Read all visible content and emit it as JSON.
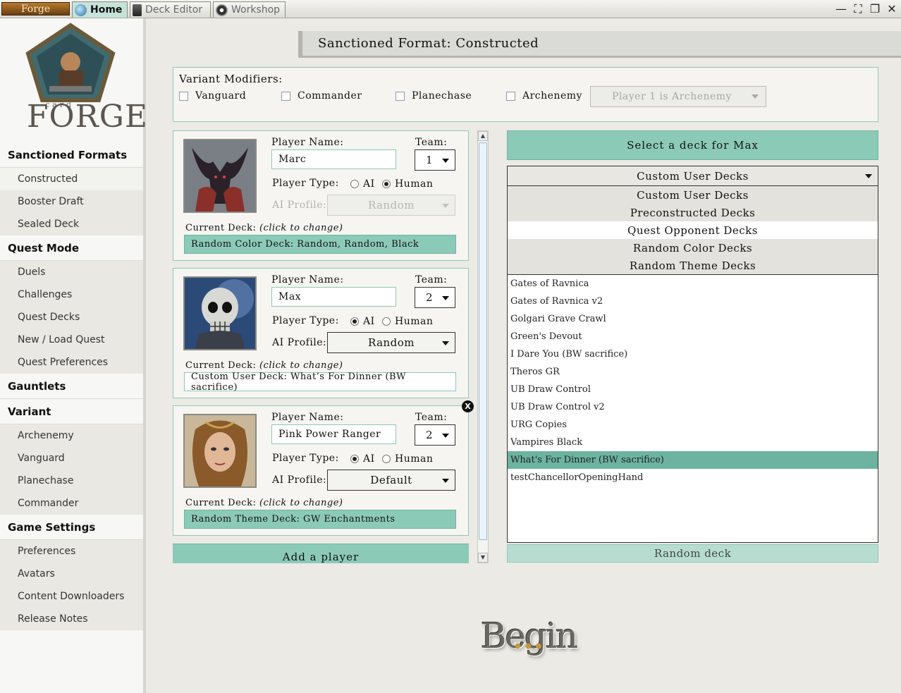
{
  "topbar": {
    "forge_label": "Forge",
    "tabs": [
      {
        "label": "Home",
        "icon": "home-globe-icon",
        "active": true
      },
      {
        "label": "Deck Editor",
        "icon": "deck-icon",
        "active": false
      },
      {
        "label": "Workshop",
        "icon": "workshop-icon",
        "active": false
      }
    ],
    "controls": {
      "minimize": "—",
      "fullscreen": "⛶",
      "restore": "❐",
      "close": "✕"
    }
  },
  "logo": {
    "small": "card",
    "big": "FORGE"
  },
  "sidebar": {
    "sections": [
      {
        "title": "Sanctioned Formats",
        "items": [
          "Constructed",
          "Booster Draft",
          "Sealed Deck"
        ]
      },
      {
        "title": "Quest Mode",
        "items": [
          "Duels",
          "Challenges",
          "Quest Decks",
          "New / Load Quest",
          "Quest Preferences"
        ]
      },
      {
        "title": "Gauntlets",
        "items": []
      },
      {
        "title": "Variant",
        "items": [
          "Archenemy",
          "Vanguard",
          "Planechase",
          "Commander"
        ]
      },
      {
        "title": "Game Settings",
        "items": [
          "Preferences",
          "Avatars",
          "Content Downloaders",
          "Release Notes"
        ]
      }
    ]
  },
  "main": {
    "format_title": "Sanctioned Format: Constructed",
    "variants": {
      "label": "Variant Modifiers:",
      "options": [
        "Vanguard",
        "Commander",
        "Planechase",
        "Archenemy"
      ],
      "archenemy_select": "Player 1 is Archenemy"
    },
    "labels": {
      "player_name": "Player Name:",
      "team": "Team:",
      "player_type": "Player Type:",
      "ai": "AI",
      "human": "Human",
      "ai_profile": "AI Profile:",
      "current_deck": "Current Deck:",
      "click_to_change": "(click to change)"
    },
    "players": [
      {
        "name": "Marc",
        "team": "1",
        "type": "Human",
        "ai_profile": "Random",
        "deck": "Random Color Deck: Random, Random, Black"
      },
      {
        "name": "Max",
        "team": "2",
        "type": "AI",
        "ai_profile": "Random",
        "deck": "Custom User Deck: What’s For Dinner (BW sacrifice)"
      },
      {
        "name": "Pink Power Ranger",
        "team": "2",
        "type": "AI",
        "ai_profile": "Default",
        "deck": "Random Theme Deck: GW Enchantments"
      }
    ],
    "add_player": "Add a player",
    "remove_icon": "X"
  },
  "deck_panel": {
    "header": "Select a deck for Max",
    "selected_category": "Custom User Decks",
    "categories": [
      "Custom User Decks",
      "Preconstructed Decks",
      "Quest Opponent Decks",
      "Random Color Decks",
      "Random Theme Decks"
    ],
    "hovered_category": "Quest Opponent Decks",
    "decks": [
      "Gates of Ravnica",
      "Gates of Ravnica v2",
      "Golgari Grave Crawl",
      "Green's Devout",
      "I Dare You (BW sacrifice)",
      "Theros GR",
      "UB Draw Control",
      "UB Draw Control v2",
      "URG Copies",
      "Vampires Black",
      "What's For Dinner (BW sacrifice)",
      "testChancellorOpeningHand"
    ],
    "selected_deck": "What's For Dinner (BW sacrifice)",
    "random_deck": "Random deck"
  },
  "begin": {
    "label": "Begin"
  },
  "colors": {
    "accent": "#8ccab8",
    "selected_row": "#6cb3a0",
    "border": "#8fc8b7"
  }
}
